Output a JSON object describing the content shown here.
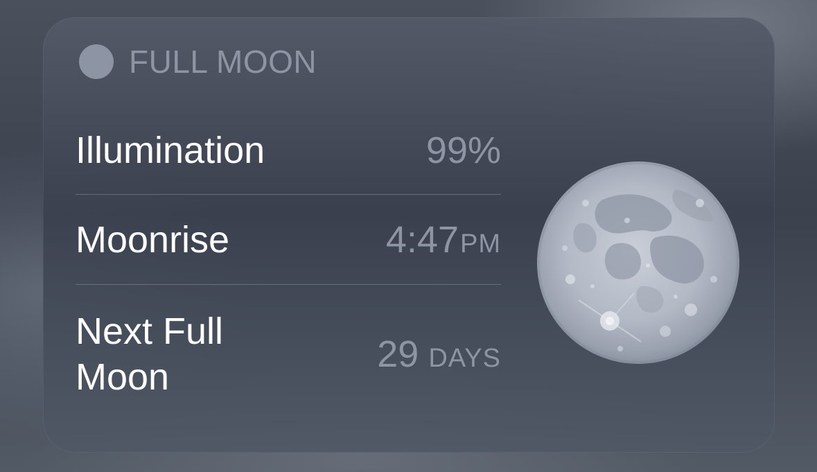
{
  "widget": {
    "phase_title": "FULL MOON",
    "phase_icon": "full-moon-dot-icon",
    "accent_color": "#8d94a3",
    "rows": [
      {
        "label": "Illumination",
        "value": "99%",
        "unit": ""
      },
      {
        "label": "Moonrise",
        "value": "4:47",
        "unit": "PM"
      },
      {
        "label": "Next Full Moon",
        "value": "29",
        "unit": "DAYS"
      }
    ],
    "moon_image": "full-moon-illustration"
  }
}
